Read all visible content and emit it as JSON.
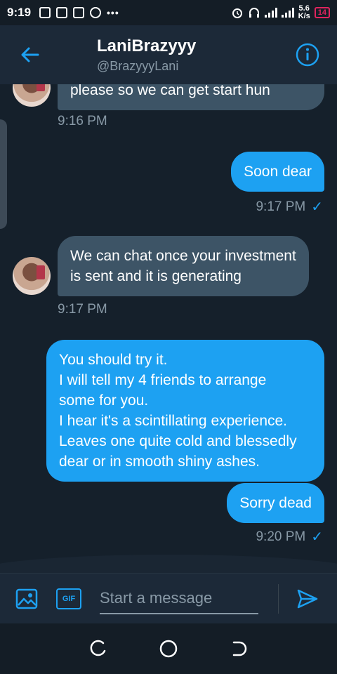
{
  "status_bar": {
    "time": "9:19",
    "more": "•••",
    "net_speed_top": "5.6",
    "net_speed_bottom": "K/s",
    "battery": "14"
  },
  "header": {
    "back_icon": "arrow-left-icon",
    "name": "LaniBrazyyy",
    "handle": "@BrazyyyLani",
    "info_icon": "info-icon"
  },
  "messages": [
    {
      "direction": "in",
      "lines": [
        "please so we can get start hun"
      ],
      "time": "9:16 PM"
    },
    {
      "direction": "out",
      "lines": [
        "Soon dear"
      ],
      "time": "9:17 PM",
      "read": "✓"
    },
    {
      "direction": "in",
      "lines": [
        "We can chat once your investment",
        "is sent and it is generating"
      ],
      "time": "9:17 PM"
    },
    {
      "direction": "out",
      "lines": [
        "You should try it.",
        "I will tell my 4 friends to arrange",
        "some for you.",
        "I hear it's a scintillating experience.",
        "Leaves one quite cold and blessedly",
        "dear or in smooth shiny ashes."
      ],
      "time": ""
    },
    {
      "direction": "out",
      "lines": [
        "Sorry dead"
      ],
      "time": "9:20 PM",
      "read": "✓"
    }
  ],
  "composer": {
    "media_icon": "image-icon",
    "gif_label": "GIF",
    "placeholder": "Start a message",
    "send_icon": "send-icon"
  },
  "navbar": {
    "recents_icon": "recents-icon",
    "home_icon": "home-icon",
    "back_icon": "back-icon"
  },
  "colors": {
    "background": "#15202b",
    "header": "#1c2938",
    "incoming_bubble": "#3d5466",
    "outgoing_bubble": "#1da1f2",
    "muted_text": "#8899a6",
    "accent": "#1da1f2",
    "battery_low": "#e0245e"
  }
}
